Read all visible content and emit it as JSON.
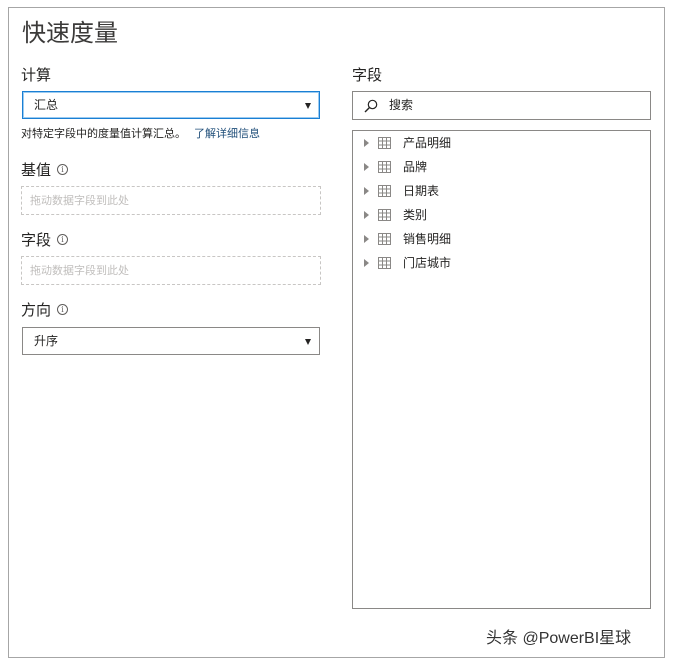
{
  "title": "快速度量",
  "calc": {
    "label": "计算",
    "selected": "汇总",
    "description": "对特定字段中的度量值计算汇总。",
    "learn_more": "了解详细信息"
  },
  "base": {
    "label": "基值",
    "placeholder": "拖动数据字段到此处"
  },
  "field": {
    "label": "字段",
    "placeholder": "拖动数据字段到此处"
  },
  "direction": {
    "label": "方向",
    "selected": "升序"
  },
  "fields_panel": {
    "label": "字段",
    "search_placeholder": "搜索",
    "items": [
      {
        "label": "产品明细",
        "icon": "table-icon"
      },
      {
        "label": "品牌",
        "icon": "table-icon"
      },
      {
        "label": "日期表",
        "icon": "table-icon"
      },
      {
        "label": "类别",
        "icon": "table-icon"
      },
      {
        "label": "销售明细",
        "icon": "table-icon"
      },
      {
        "label": "门店城市",
        "icon": "table-icon"
      }
    ]
  },
  "watermark": "头条 @PowerBI星球",
  "info_glyph": "i",
  "colors": {
    "focus_border": "#1a7fd4",
    "link": "#1f4e79",
    "border": "#8a8886"
  }
}
